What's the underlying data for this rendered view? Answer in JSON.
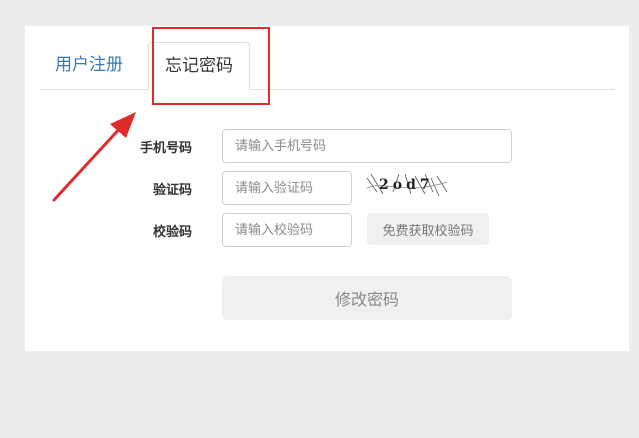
{
  "tabs": {
    "register": "用户注册",
    "forgot": "忘记密码"
  },
  "form": {
    "phone_label": "手机号码",
    "phone_placeholder": "请输入手机号码",
    "captcha_label": "验证码",
    "captcha_placeholder": "请输入验证码",
    "captcha_text": "2od7",
    "code_label": "校验码",
    "code_placeholder": "请输入校验码",
    "get_code_button": "免费获取校验码",
    "submit_button": "修改密码"
  },
  "colors": {
    "accent": "#337ab7",
    "highlight": "#e02b2b"
  }
}
